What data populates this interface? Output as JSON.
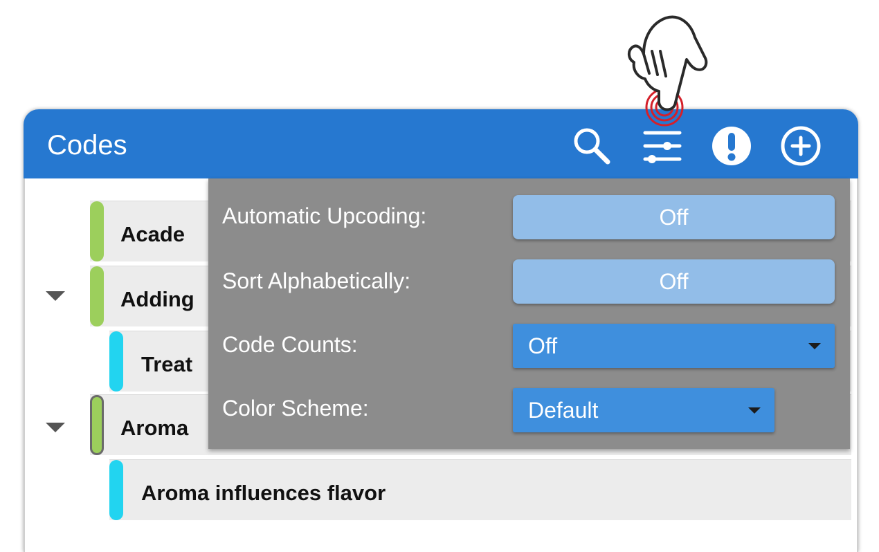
{
  "panel": {
    "title": "Codes",
    "header_color": "#2678d0",
    "icons": [
      "search-icon",
      "filter-sliders-icon",
      "alert-icon",
      "add-circle-icon"
    ]
  },
  "codes": [
    {
      "label": "Acade",
      "color": "#9ccf5c",
      "expanded": false
    },
    {
      "label": "Adding",
      "color": "#9ccf5c",
      "expanded": true
    },
    {
      "label": "Treat",
      "color": "#22d4f0",
      "expanded": false
    },
    {
      "label": "Aroma",
      "color": "#9ccf5c",
      "expanded": true
    },
    {
      "label": "Aroma influences flavor",
      "color": "#22d4f0",
      "expanded": false
    }
  ],
  "settings": {
    "automatic_upcoding": {
      "label": "Automatic Upcoding:",
      "value": "Off"
    },
    "sort_alphabetically": {
      "label": "Sort Alphabetically:",
      "value": "Off"
    },
    "code_counts": {
      "label": "Code Counts:",
      "value": "Off"
    },
    "color_scheme": {
      "label": "Color Scheme:",
      "value": "Default"
    }
  },
  "colors": {
    "menu_bg": "#8c8c8c",
    "toggle_off": "#92bde8",
    "select_bg": "#3f8fdd",
    "tap_ring": "#d4202a"
  }
}
